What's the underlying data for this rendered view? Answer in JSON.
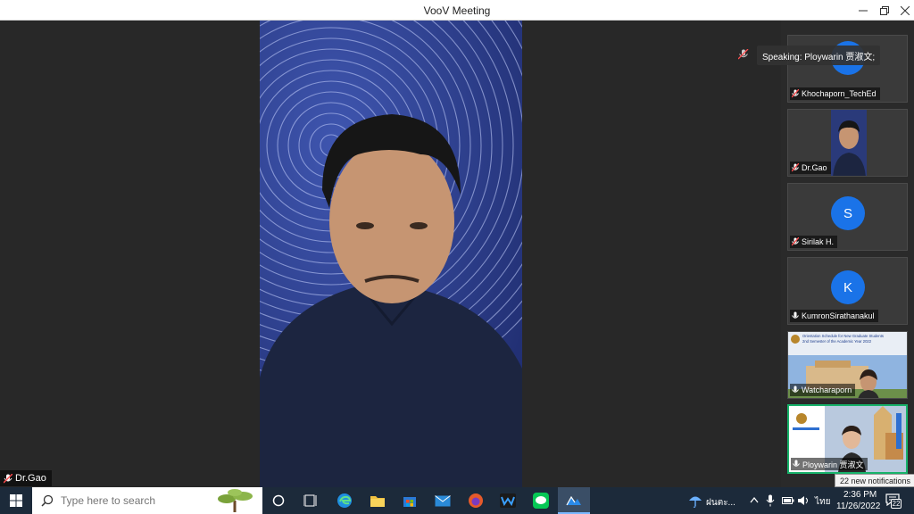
{
  "window": {
    "title": "VooV Meeting"
  },
  "main_video": {
    "speaker_label": "Dr.Gao"
  },
  "speaking_indicator": {
    "text": "Speaking: Ploywarin 贾淑文;"
  },
  "participants": [
    {
      "name": "Khochaporn_TechEd",
      "avatar_letter": "",
      "muted": true
    },
    {
      "name": "Dr.Gao",
      "avatar_letter": "",
      "muted": true
    },
    {
      "name": "Sirilak H.",
      "avatar_letter": "S",
      "muted": true
    },
    {
      "name": "KumronSirathanakul",
      "avatar_letter": "K",
      "muted": false
    },
    {
      "name": "Watcharaporn",
      "avatar_letter": "",
      "muted": false
    },
    {
      "name": "Ploywarin 贾淑文",
      "avatar_letter": "",
      "muted": false
    }
  ],
  "slide_preview": {
    "line1": "Orientation Schedule for New Graduate Students",
    "line2": "2nd Semester of the Academic Year 2022"
  },
  "taskbar": {
    "search_placeholder": "Type here to search",
    "weather_text": "ฝนตะ...",
    "language": "ไทย",
    "time": "2:36 PM",
    "date": "11/26/2022",
    "notification_count": "22"
  },
  "notification_tooltip": "22 new notifications",
  "colors": {
    "avatar_blue": "#1a73e8",
    "active_border": "#17b26a",
    "taskbar": "#1c2a3a"
  }
}
